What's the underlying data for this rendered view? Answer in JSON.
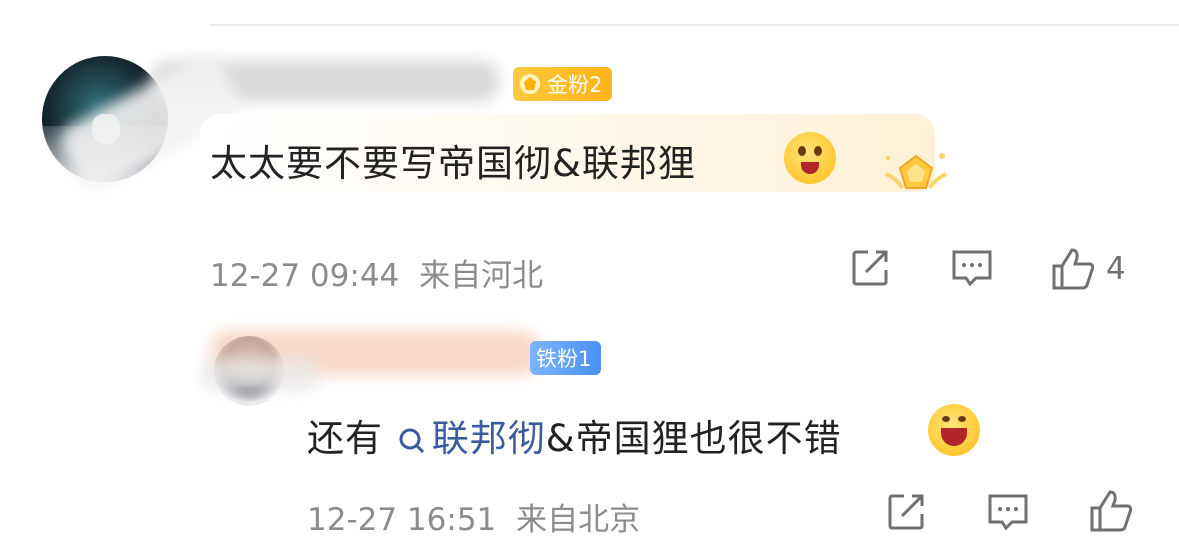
{
  "comments": [
    {
      "fan_badge": "金粉2",
      "text_prefix": "太太要不要写帝国彻&联邦狸",
      "time": "12-27 09:44",
      "location": "来自河北",
      "like_count": "4",
      "colors": {
        "badge": "#ffbf2e"
      }
    },
    {
      "fan_badge": "铁粉1",
      "text_prefix": "还有",
      "link_text": "联邦彻",
      "text_suffix": "&帝国狸也很不错",
      "time": "12-27 16:51",
      "location": "来自北京",
      "colors": {
        "badge": "#5b9cf6",
        "link": "#3b5b9f"
      }
    }
  ],
  "icons": [
    "share-icon",
    "comment-icon",
    "like-icon",
    "search-icon",
    "emoji-icon"
  ]
}
